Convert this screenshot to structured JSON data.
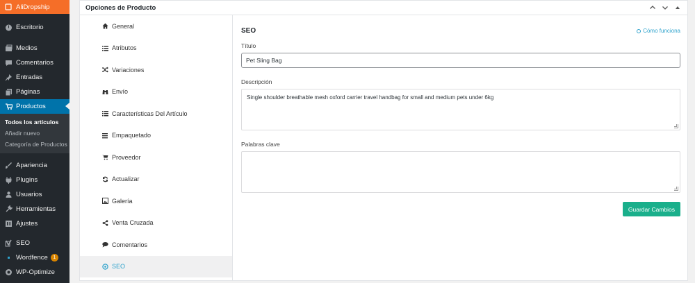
{
  "sidebar": {
    "items": [
      {
        "label": "AliDropship",
        "icon": "alidropship-icon"
      },
      {
        "label": "Escritorio",
        "icon": "dashboard-icon"
      },
      {
        "label": "Medios",
        "icon": "media-icon"
      },
      {
        "label": "Comentarios",
        "icon": "comments-icon"
      },
      {
        "label": "Entradas",
        "icon": "pin-icon"
      },
      {
        "label": "Páginas",
        "icon": "pages-icon"
      },
      {
        "label": "Productos",
        "icon": "cart-icon"
      },
      {
        "label": "Apariencia",
        "icon": "brush-icon"
      },
      {
        "label": "Plugins",
        "icon": "plugin-icon"
      },
      {
        "label": "Usuarios",
        "icon": "users-icon"
      },
      {
        "label": "Herramientas",
        "icon": "wrench-icon"
      },
      {
        "label": "Ajustes",
        "icon": "settings-icon"
      },
      {
        "label": "SEO",
        "icon": "yoast-icon"
      },
      {
        "label": "Wordfence",
        "icon": "wordfence-icon",
        "badge": "1"
      },
      {
        "label": "WP-Optimize",
        "icon": "optimize-icon"
      }
    ],
    "submenu": [
      "Todos los artículos",
      "Añadir nuevo",
      "Categoría de Productos"
    ]
  },
  "postbox": {
    "title": "Opciones de Producto",
    "tabs": [
      {
        "label": "General",
        "icon": "home-icon"
      },
      {
        "label": "Atributos",
        "icon": "list-icon"
      },
      {
        "label": "Variaciones",
        "icon": "shuffle-icon"
      },
      {
        "label": "Envío",
        "icon": "binoculars-icon"
      },
      {
        "label": "Características Del Artículo",
        "icon": "list-icon"
      },
      {
        "label": "Empaquetado",
        "icon": "menu-icon"
      },
      {
        "label": "Proveedor",
        "icon": "cart-icon"
      },
      {
        "label": "Actualizar",
        "icon": "refresh-icon"
      },
      {
        "label": "Galería",
        "icon": "image-icon"
      },
      {
        "label": "Venta Cruzada",
        "icon": "share-icon"
      },
      {
        "label": "Comentarios",
        "icon": "comment-icon"
      },
      {
        "label": "SEO",
        "icon": "target-icon"
      }
    ],
    "active_tab": "SEO"
  },
  "seo": {
    "heading": "SEO",
    "howto": "Cómo funciona",
    "title_label": "Título",
    "title_value": "Pet Sling Bag",
    "description_label": "Descripción",
    "description_value": "Single shoulder breathable mesh oxford carrier travel handbag for small and medium pets under 6kg",
    "keywords_label": "Palabras clave",
    "keywords_value": "",
    "save_label": "Guardar Cambios"
  },
  "colors": {
    "sidebar_bg": "#23282d",
    "brand_orange": "#f56e28",
    "current_blue": "#0073aa",
    "accent": "#2ea2cc",
    "save_green": "#1aaf8b"
  }
}
